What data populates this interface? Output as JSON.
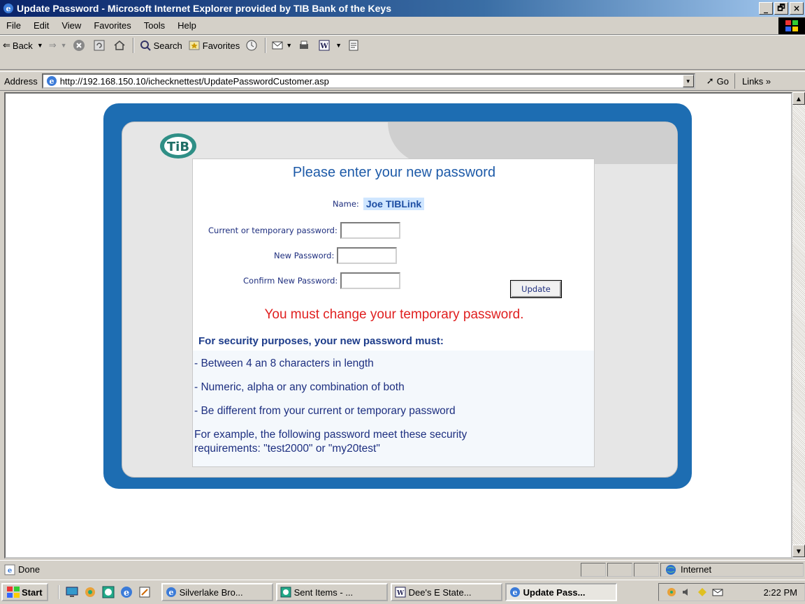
{
  "window": {
    "title": "Update Password - Microsoft Internet Explorer provided by TIB Bank of the Keys",
    "min_label": "_",
    "max_label": "🗗",
    "close_label": "×"
  },
  "menu": [
    "File",
    "Edit",
    "View",
    "Favorites",
    "Tools",
    "Help"
  ],
  "toolbar": {
    "back_label": "Back",
    "search_label": "Search",
    "favorites_label": "Favorites"
  },
  "address": {
    "label": "Address",
    "url": "http://192.168.150.10/ichecknettest/UpdatePasswordCustomer.asp",
    "go_label": "Go",
    "links_label": "Links »"
  },
  "page": {
    "form_title": "Please enter your new password",
    "name_label": "Name:",
    "name_value": "Joe TIBLink",
    "current_password_label": "Current or temporary password:",
    "new_password_label": "New Password:",
    "confirm_password_label": "Confirm New Password:",
    "update_button": "Update",
    "warning": "You must change your temporary password.",
    "rules_title": "For security purposes, your new password must:",
    "rules": [
      "- Between 4 an 8 characters in length",
      "- Numeric, alpha or any combination of both",
      "- Be different from your current or temporary password"
    ],
    "example_line1": "For example, the following password meet these security",
    "example_line2": "requirements: \"test2000\" or \"my20test\""
  },
  "status": {
    "text": "Done",
    "zone": "Internet"
  },
  "taskbar": {
    "start": "Start",
    "tasks": [
      "Silverlake Bro...",
      "Sent Items - ...",
      "Dee's E State...",
      "Update Pass..."
    ],
    "clock": "2:22 PM"
  }
}
